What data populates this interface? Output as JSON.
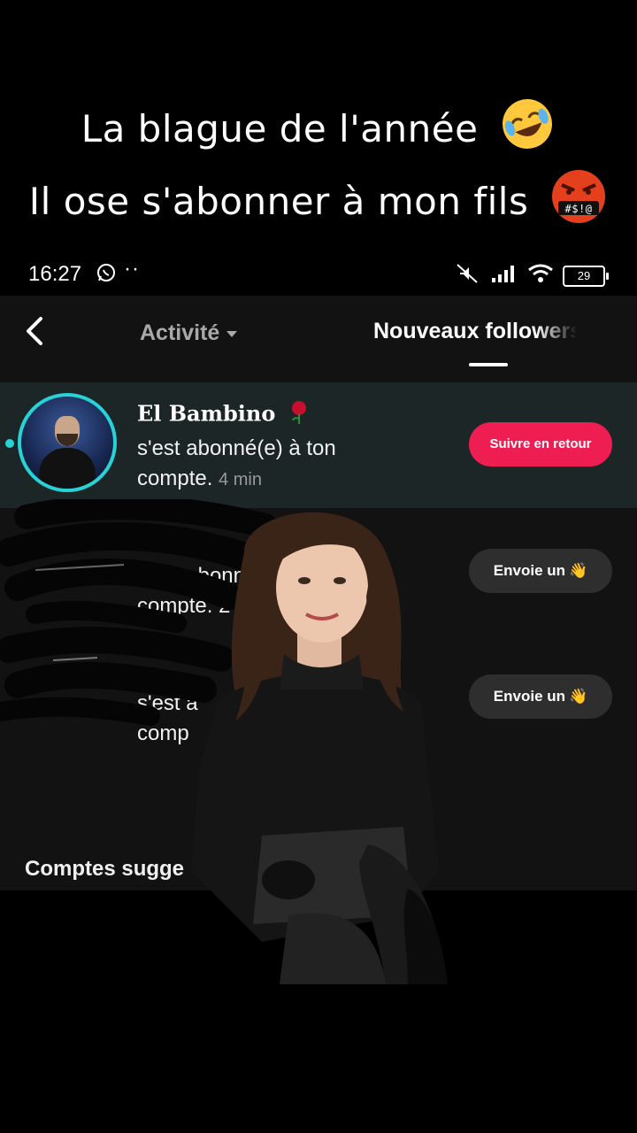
{
  "caption": {
    "line1": "La blague de l'année",
    "line2": "Il ose s'abonner à mon fils"
  },
  "status_bar": {
    "time": "16:27",
    "extra": "··",
    "battery": "29"
  },
  "nav": {
    "activity_tab": "Activité",
    "new_followers_tab": "Nouveaux followers"
  },
  "notifications": [
    {
      "username": "El Bambino",
      "message": "s'est abonné(e) à ton compte.",
      "time": "4 min",
      "button": "Suivre en retour"
    },
    {
      "message": "s'est abonn",
      "message2": "compte. 2",
      "button": "Envoie un"
    },
    {
      "message": "s'est a",
      "message2": "comp",
      "button": "Envoie un"
    }
  ],
  "suggested_title": "Comptes sugge",
  "colors": {
    "accent_red": "#ee1d52",
    "ring_cyan": "#27d3d6",
    "background": "#121212",
    "highlight_row": "#1c2626"
  },
  "icons": [
    "whatsapp-icon",
    "mute-icon",
    "signal-icon",
    "wifi-icon",
    "battery-icon",
    "back-arrow-icon",
    "rose-icon",
    "wave-icon",
    "laughing-emoji-icon",
    "swearing-emoji-icon"
  ]
}
